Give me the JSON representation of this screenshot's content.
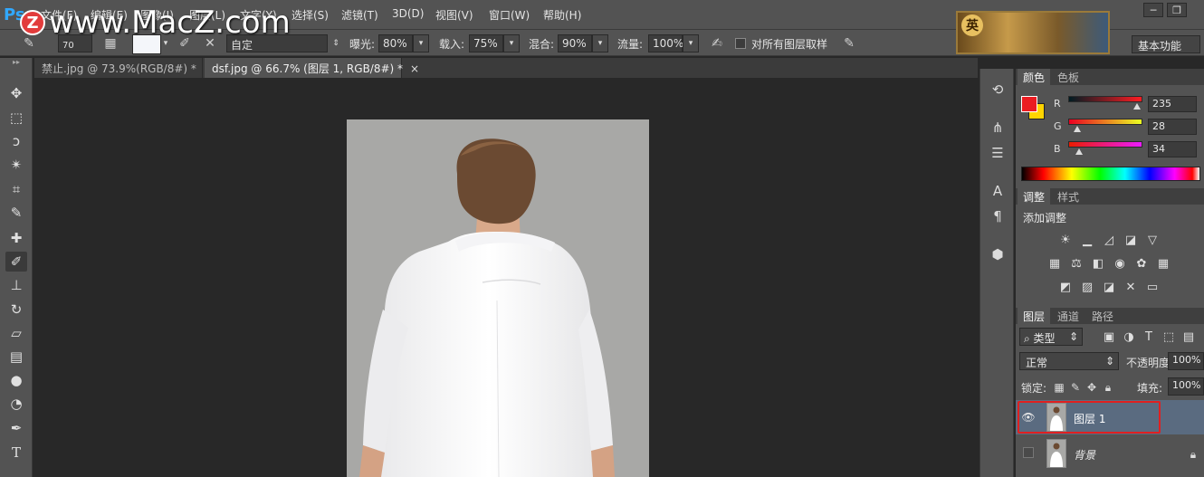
{
  "app": {
    "logo": "Ps",
    "watermark_letter": "Z",
    "watermark_text": "www.MacZ.com",
    "banner_badge": "英"
  },
  "menu": [
    {
      "label": "文件(F)"
    },
    {
      "label": "编辑(E)"
    },
    {
      "label": "图像(I)"
    },
    {
      "label": "图层(L)"
    },
    {
      "label": "文字(Y)"
    },
    {
      "label": "选择(S)"
    },
    {
      "label": "滤镜(T)"
    },
    {
      "label": "3D(D)"
    },
    {
      "label": "视图(V)"
    },
    {
      "label": "窗口(W)"
    },
    {
      "label": "帮助(H)"
    }
  ],
  "window_controls": {
    "minimize": "─",
    "restore": "❐"
  },
  "options": {
    "brush_size": "70",
    "mode_value": "自定",
    "exposure_label": "曝光:",
    "exposure_value": "80%",
    "load_label": "载入:",
    "load_value": "75%",
    "mix_label": "混合:",
    "mix_value": "90%",
    "flow_label": "流量:",
    "flow_value": "100%",
    "sample_all_label": "对所有图层取样",
    "workspace": "基本功能"
  },
  "tabs": [
    {
      "label": "禁止.jpg @ 73.9%(RGB/8#) *",
      "close": "×"
    },
    {
      "label": "dsf.jpg @ 66.7% (图层 1, RGB/8#) *",
      "close": "×"
    }
  ],
  "tools": [
    {
      "name": "move-tool-icon",
      "glyph": "✥"
    },
    {
      "name": "marquee-tool-icon",
      "glyph": "⬚"
    },
    {
      "name": "lasso-tool-icon",
      "glyph": "ↄ"
    },
    {
      "name": "magic-wand-tool-icon",
      "glyph": "✴"
    },
    {
      "name": "crop-tool-icon",
      "glyph": "⌗"
    },
    {
      "name": "eyedropper-tool-icon",
      "glyph": "✎"
    },
    {
      "name": "healing-brush-tool-icon",
      "glyph": "✚"
    },
    {
      "name": "mixer-brush-tool-icon",
      "glyph": "✐"
    },
    {
      "name": "clone-stamp-tool-icon",
      "glyph": "⊥"
    },
    {
      "name": "history-brush-tool-icon",
      "glyph": "↻"
    },
    {
      "name": "eraser-tool-icon",
      "glyph": "▱"
    },
    {
      "name": "gradient-tool-icon",
      "glyph": "▤"
    },
    {
      "name": "blur-tool-icon",
      "glyph": "●"
    },
    {
      "name": "dodge-tool-icon",
      "glyph": "◔"
    },
    {
      "name": "pen-tool-icon",
      "glyph": "✒"
    },
    {
      "name": "type-tool-icon",
      "glyph": "T"
    }
  ],
  "color_panel": {
    "tabs": [
      "颜色",
      "色板"
    ],
    "r_label": "R",
    "r_value": "235",
    "g_label": "G",
    "g_value": "28",
    "b_label": "B",
    "b_value": "34",
    "foreground": "#eb1c22",
    "background": "#ffd400"
  },
  "adjust_panel": {
    "tabs": [
      "调整",
      "样式"
    ],
    "title": "添加调整"
  },
  "layers_panel": {
    "tabs": [
      "图层",
      "通道",
      "路径"
    ],
    "filter_label": "类型",
    "blend_mode": "正常",
    "opacity_label": "不透明度:",
    "opacity_value": "100%",
    "lock_label": "锁定:",
    "fill_label": "填充:",
    "fill_value": "100%",
    "layers": [
      {
        "name": "图层 1",
        "visible": true,
        "selected": true
      },
      {
        "name": "背景",
        "visible": false,
        "selected": false
      }
    ]
  },
  "colors": {
    "selection_outline": "#e02020",
    "selected_layer_bg": "#5a6b80"
  }
}
